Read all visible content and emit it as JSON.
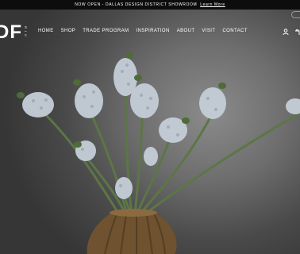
{
  "announcement": {
    "text": "NOW OPEN - DALLAS DESIGN DISTRICT SHOWROOM",
    "link": "Learn More"
  },
  "logo": {
    "mark": "DF",
    "small": "R I K"
  },
  "nav": {
    "items": [
      {
        "label": "HOME"
      },
      {
        "label": "SHOP"
      },
      {
        "label": "TRADE PROGRAM"
      },
      {
        "label": "INSPIRATION"
      },
      {
        "label": "ABOUT"
      },
      {
        "label": "VISIT"
      },
      {
        "label": "CONTACT"
      }
    ]
  },
  "icons": {
    "account": "user-icon",
    "cart": "cart-icon"
  },
  "colors": {
    "announcement_bg": "#0d0d0d",
    "text": "#ffffff",
    "stem": "#5f7a47",
    "flower": "#c7d0da",
    "vase": "#7a5a33"
  }
}
